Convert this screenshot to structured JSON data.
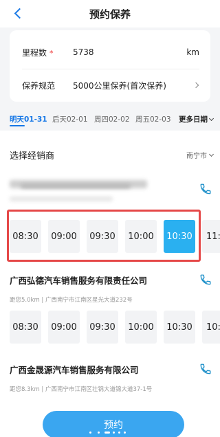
{
  "header": {
    "title": "预约保养"
  },
  "form": {
    "mileage_label": "里程数",
    "mileage_required": "*",
    "mileage_value": "5738",
    "mileage_unit": "km",
    "spec_label": "保养规范",
    "spec_value": "5000公里保养(首次保养)"
  },
  "date_tabs": [
    "明天01-31",
    "后天02-01",
    "周四02-02",
    "周五02-03"
  ],
  "more_dates": "更多日期",
  "dealer_section": {
    "title": "选择经销商",
    "city": "南宁市"
  },
  "dealers": [
    {
      "name": "",
      "address": "",
      "slots": [
        "08:30",
        "09:00",
        "09:30",
        "10:00",
        "10:30",
        "11:"
      ],
      "selected": "10:30"
    },
    {
      "name": "广西弘德汽车销售服务有限责任公司",
      "address": "距您5.0km | 广西南宁市江南区星光大道232号",
      "slots": [
        "08:30",
        "09:00",
        "09:30",
        "10:00",
        "10:30",
        "10:30"
      ]
    },
    {
      "name": "广西金晟源汽车销售服务有限公司",
      "address": "距您8.3km | 广西南宁市江南区壮锦大道锦大道37-1号"
    }
  ],
  "book_button": "预约",
  "colors": {
    "accent": "#1677e6",
    "selected_slot": "#2ab0f0",
    "button": "#3aa6f0",
    "highlight_box": "#e54848"
  }
}
